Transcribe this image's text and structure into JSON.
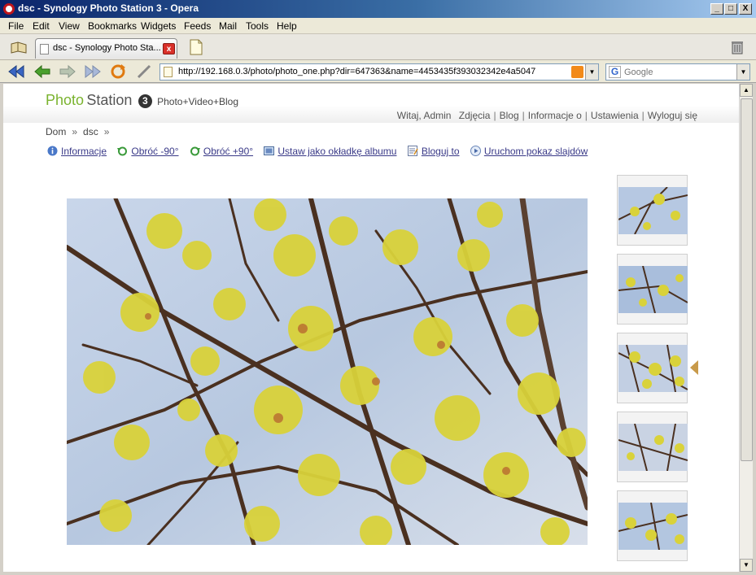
{
  "window": {
    "title": "dsc - Synology Photo Station 3 - Opera",
    "minimize": "_",
    "maximize": "□",
    "close": "X"
  },
  "menu": [
    "File",
    "Edit",
    "View",
    "Bookmarks",
    "Widgets",
    "Feeds",
    "Mail",
    "Tools",
    "Help"
  ],
  "tab": {
    "label": "dsc - Synology Photo Sta...",
    "close": "x"
  },
  "address": {
    "url": "http://192.168.0.3/photo/photo_one.php?dir=647363&name=4453435f393032342e4a5047"
  },
  "search": {
    "placeholder": "Google",
    "engine_letter": "G"
  },
  "header": {
    "logo_photo": "Photo",
    "logo_station": "Station",
    "logo_number": "3",
    "logo_tagline": "Photo+Video+Blog",
    "greeting": "Witaj, Admin",
    "links": [
      "Zdjęcia",
      "Blog",
      "Informacje o",
      "Ustawienia",
      "Wyloguj się"
    ]
  },
  "breadcrumb": {
    "home": "Dom",
    "sep": "»",
    "current": "dsc",
    "sep2": "»"
  },
  "actions": [
    {
      "label": "Informacje",
      "icon": "info-icon"
    },
    {
      "label": "Obróć -90°",
      "icon": "rotate-left-icon"
    },
    {
      "label": "Obróć +90°",
      "icon": "rotate-right-icon"
    },
    {
      "label": "Ustaw jako okładkę albumu",
      "icon": "album-cover-icon"
    },
    {
      "label": "Bloguj to",
      "icon": "blog-icon"
    },
    {
      "label": "Uruchom pokaz slajdów",
      "icon": "slideshow-icon"
    }
  ],
  "thumbnails": {
    "count": 5,
    "selected_index": 2
  },
  "colors": {
    "accent_green": "#7ab32e",
    "link": "#3a3a88",
    "pointer": "#c89a4a"
  }
}
